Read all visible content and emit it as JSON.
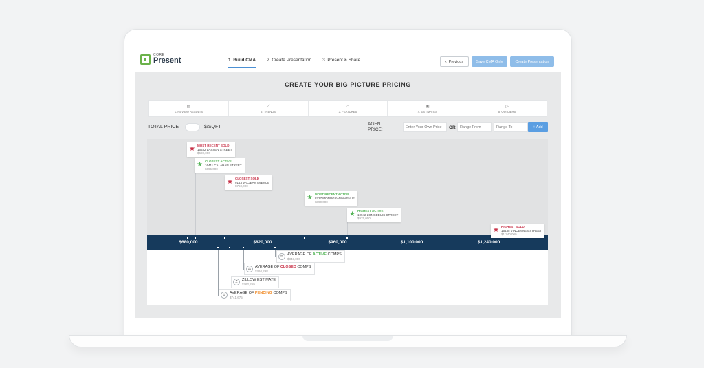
{
  "logo": {
    "small": "CORE",
    "big": "Present"
  },
  "nav": {
    "steps": [
      "1. Build CMA",
      "2. Create Presentation",
      "3. Present & Share"
    ],
    "previous": "Previous",
    "save_cma": "Save CMA Only",
    "create_presentation": "Create Presentation"
  },
  "page": {
    "title": "CREATE YOUR BIG PICTURE PRICING"
  },
  "tabs": [
    {
      "icon": "list-icon",
      "label": "1. REVIEW RESULTS"
    },
    {
      "icon": "trend-chart-icon",
      "label": "2. TRENDS"
    },
    {
      "icon": "home-icon",
      "label": "3. FEATURES"
    },
    {
      "icon": "clipboard-icon",
      "label": "4. ESTIMATES"
    },
    {
      "icon": "send-icon",
      "label": "5. OUTLIERS"
    }
  ],
  "controls": {
    "total_price": "TOTAL PRICE",
    "per_sqft": "$/SQFT",
    "agent_price": "AGENT PRICE:",
    "own_price_placeholder": "Enter Your Own Price",
    "or": "OR",
    "range_from_placeholder": "Range From",
    "range_to_placeholder": "Range To",
    "add": "+ Add"
  },
  "axis": {
    "ticks": [
      "$680,000",
      "$820,000",
      "$960,000",
      "$1,100,000",
      "$1,240,000"
    ]
  },
  "comps": [
    {
      "title": "MOST RECENT SOLD",
      "address": "16632 LASSEN STREET",
      "price": "$680,000",
      "status": "sold"
    },
    {
      "title": "CLOSEST ACTIVE",
      "address": "16411 CALAHAN STREET",
      "price": "$695,000",
      "status": "active"
    },
    {
      "title": "CLOSEST SOLD",
      "address": "9143 VALJEAN AVENUE",
      "price": "$750,000",
      "status": "sold"
    },
    {
      "title": "MOST RECENT ACTIVE",
      "address": "8727 MONOGRAM AVENUE",
      "price": "$890,000",
      "status": "active"
    },
    {
      "title": "HIGHEST ACTIVE",
      "address": "10942 LONGDEUIS STREET",
      "price": "$975,000",
      "status": "active"
    },
    {
      "title": "HIGHEST SOLD",
      "address": "16435 VINCENNES STREET",
      "price": "$1,240,000",
      "status": "sold"
    }
  ],
  "averages": [
    {
      "prefix": "AVERAGE OF ",
      "highlight": "ACTIVE",
      "suffix": " COMPS",
      "value": "$843,000",
      "icon": "scale-icon"
    },
    {
      "prefix": "AVERAGE OF ",
      "highlight": "CLOSED",
      "suffix": " COMPS",
      "value": "$794,298",
      "icon": "scale-icon"
    },
    {
      "prefix": "ZILLOW ESTIMATE",
      "highlight": "",
      "suffix": "",
      "value": "$762,259",
      "icon": "zillow-icon"
    },
    {
      "prefix": "AVERAGE OF ",
      "highlight": "PENDING",
      "suffix": " COMPS",
      "value": "$741,675",
      "icon": "scale-icon"
    }
  ]
}
